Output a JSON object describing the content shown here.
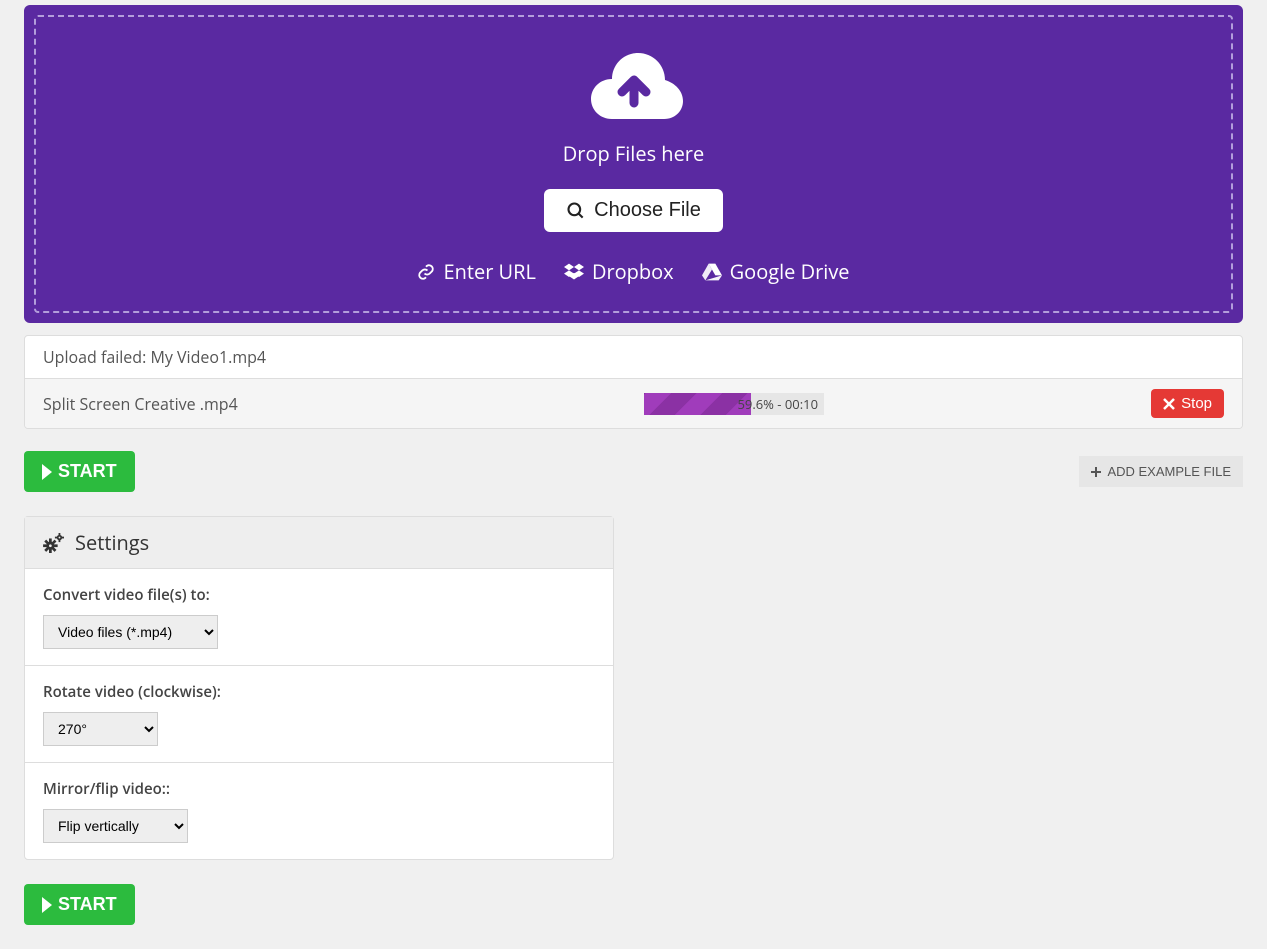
{
  "dropzone": {
    "drop_label": "Drop Files here",
    "choose_file_label": "Choose File",
    "links": {
      "enter_url": "Enter URL",
      "dropbox": "Dropbox",
      "gdrive": "Google Drive"
    }
  },
  "files": {
    "failed": {
      "text": "Upload failed: My Video1.mp4"
    },
    "uploading": {
      "name": "Split Screen Creative .mp4",
      "progress_percent": 59.6,
      "progress_label": "59.6% - 00:10",
      "stop_label": "Stop"
    }
  },
  "buttons": {
    "start_label": "START",
    "add_example_label": "ADD EXAMPLE FILE"
  },
  "settings": {
    "header": "Settings",
    "convert": {
      "label": "Convert video file(s) to:",
      "value": "Video files (*.mp4)"
    },
    "rotate": {
      "label": "Rotate video (clockwise):",
      "value": "270°"
    },
    "flip": {
      "label": "Mirror/flip video::",
      "value": "Flip vertically"
    }
  }
}
